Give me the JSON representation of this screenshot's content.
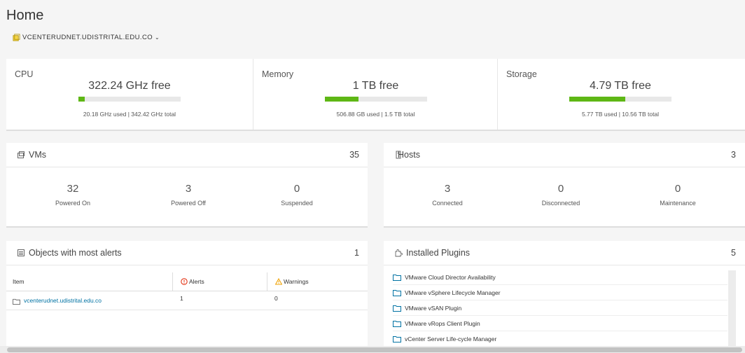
{
  "page": {
    "title": "Home"
  },
  "vcenter": {
    "name": "VCENTERUDNET.UDISTRITAL.EDU.CO"
  },
  "resources": {
    "cpu": {
      "label": "CPU",
      "free": "322.24 GHz free",
      "used_text": "20.18 GHz used | 342.42 GHz total",
      "used_fraction": 0.059
    },
    "memory": {
      "label": "Memory",
      "free": "1 TB free",
      "used_text": "506.88 GB used | 1.5 TB total",
      "used_fraction": 0.33
    },
    "storage": {
      "label": "Storage",
      "free": "4.79 TB free",
      "used_text": "5.77 TB used | 10.56 TB total",
      "used_fraction": 0.546
    }
  },
  "vms": {
    "title": "VMs",
    "count": "35",
    "stats": [
      {
        "value": "32",
        "label": "Powered On"
      },
      {
        "value": "3",
        "label": "Powered Off"
      },
      {
        "value": "0",
        "label": "Suspended"
      }
    ]
  },
  "hosts": {
    "title": "Hosts",
    "count": "3",
    "stats": [
      {
        "value": "3",
        "label": "Connected"
      },
      {
        "value": "0",
        "label": "Disconnected"
      },
      {
        "value": "0",
        "label": "Maintenance"
      }
    ]
  },
  "alerts": {
    "title": "Objects with most alerts",
    "count": "1",
    "columns": [
      "Item",
      "Alerts",
      "Warnings"
    ],
    "rows": [
      {
        "item": "vcenterudnet.udistrital.edu.co",
        "alerts": "1",
        "warnings": "0"
      }
    ]
  },
  "plugins": {
    "title": "Installed Plugins",
    "count": "5",
    "items": [
      "VMware Cloud Director Availability",
      "VMware vSphere Lifecycle Manager",
      "VMware vSAN Plugin",
      "VMware vRops Client Plugin",
      "vCenter Server Life-cycle Manager"
    ]
  },
  "colors": {
    "bar_fill": "#5eb715",
    "link": "#0072a3",
    "alert": "#e12200",
    "warning": "#efa100"
  },
  "icons": {
    "vcenter": "vcenter-icon",
    "vms": "vm-icon",
    "hosts": "host-icon",
    "alerts_card": "list-icon",
    "plugins": "plugin-icon",
    "folder": "folder-icon",
    "alert": "error-circle-icon",
    "warning": "warning-triangle-icon"
  }
}
